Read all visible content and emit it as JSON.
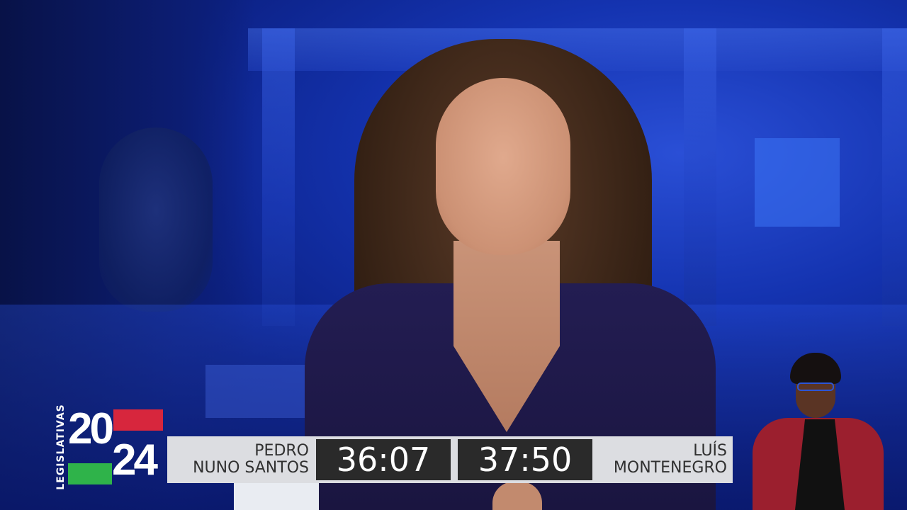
{
  "logo": {
    "vertical_text": "LEGISLATIVAS",
    "digits_top": "20",
    "digits_bottom": "24",
    "colors": {
      "red": "#d7263d",
      "green": "#2fb34a"
    }
  },
  "debate": {
    "left_candidate": {
      "line1": "PEDRO",
      "line2": "NUNO SANTOS",
      "time": "36:07"
    },
    "right_candidate": {
      "line1": "LUÍS",
      "line2": "MONTENEGRO",
      "time": "37:50"
    }
  }
}
